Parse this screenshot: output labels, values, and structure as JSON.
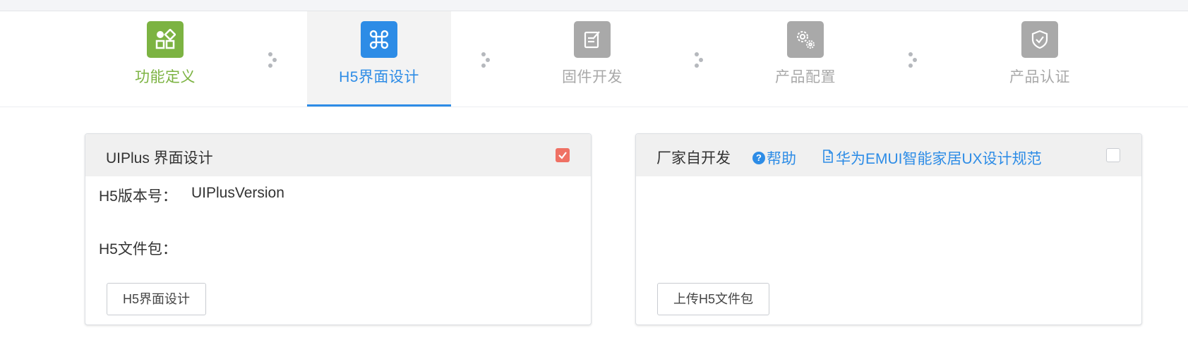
{
  "steps": [
    {
      "label": "功能定义",
      "icon": "function-define-icon",
      "color": "#7cb342",
      "state": "done"
    },
    {
      "label": "H5界面设计",
      "icon": "h5-design-icon",
      "color": "#2d8ce6",
      "state": "active"
    },
    {
      "label": "固件开发",
      "icon": "firmware-icon",
      "color": "#a9a9a9",
      "state": "pending"
    },
    {
      "label": "产品配置",
      "icon": "product-config-icon",
      "color": "#a9a9a9",
      "state": "pending"
    },
    {
      "label": "产品认证",
      "icon": "product-cert-icon",
      "color": "#a9a9a9",
      "state": "pending"
    }
  ],
  "uiplus_card": {
    "title": "UIPlus 界面设计",
    "checked": true,
    "version_label": "H5版本号：",
    "version_value": "UIPlusVersion",
    "file_label": "H5文件包：",
    "button_label": "H5界面设计"
  },
  "vendor_card": {
    "title": "厂家自开发",
    "help_label": "帮助",
    "spec_link_label": "华为EMUI智能家居UX设计规范",
    "checked": false,
    "button_label": "上传H5文件包"
  },
  "colors": {
    "accent": "#2d8ce6",
    "done": "#7cb342",
    "pending": "#a9a9a9",
    "checked": "#ef7164"
  }
}
